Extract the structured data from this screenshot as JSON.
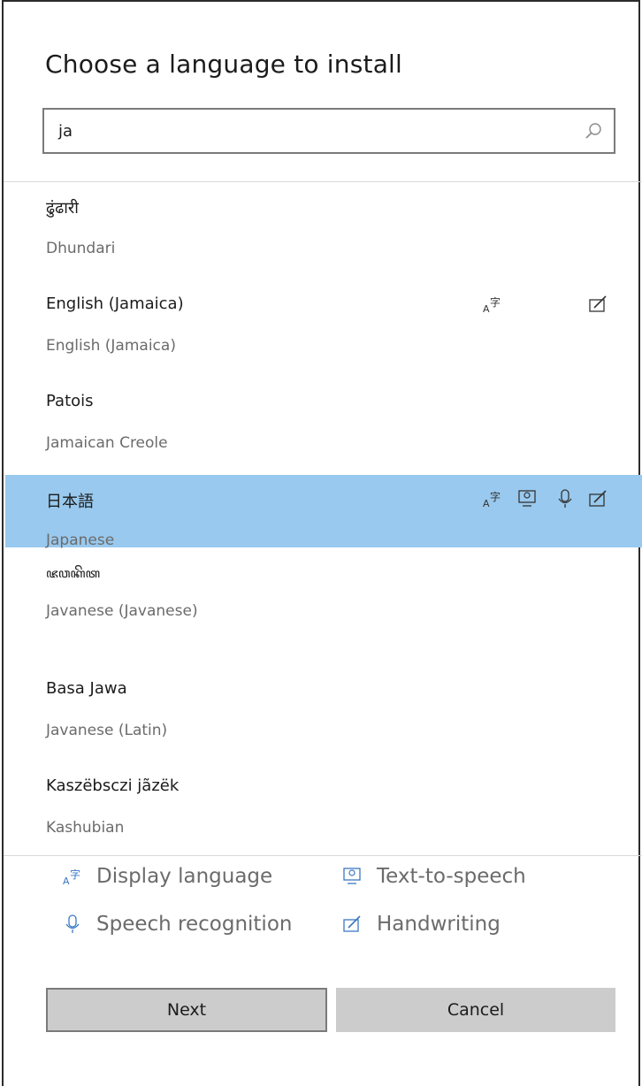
{
  "dialog": {
    "title": "Choose a language to install",
    "search": {
      "value": "ja",
      "placeholder": ""
    }
  },
  "languages": [
    {
      "native": "ढुंढारी",
      "english": "Dhundari",
      "features": [],
      "selected": false
    },
    {
      "native": "English (Jamaica)",
      "english": "English (Jamaica)",
      "features": [
        "display-language-icon",
        "handwriting-icon"
      ],
      "selected": false
    },
    {
      "native": "Patois",
      "english": "Jamaican Creole",
      "features": [],
      "selected": false
    },
    {
      "native": "日本語",
      "english": "Japanese",
      "features": [
        "display-language-icon",
        "text-to-speech-icon",
        "speech-recognition-icon",
        "handwriting-icon"
      ],
      "selected": true
    },
    {
      "native": "ꦗꦮꦏꦼꦠ",
      "english": "Javanese (Javanese)",
      "features": [],
      "selected": false
    },
    {
      "native": "Basa Jawa",
      "english": "Javanese (Latin)",
      "features": [],
      "selected": false
    },
    {
      "native": "Kaszëbsczi jãzëk",
      "english": "Kashubian",
      "features": [],
      "selected": false
    }
  ],
  "legend": {
    "display_language": "Display language",
    "text_to_speech": "Text-to-speech",
    "speech_recognition": "Speech recognition",
    "handwriting": "Handwriting"
  },
  "buttons": {
    "next": "Next",
    "cancel": "Cancel"
  },
  "colors": {
    "selected_row": "#99c9ee",
    "button_bg": "#cccccc"
  }
}
